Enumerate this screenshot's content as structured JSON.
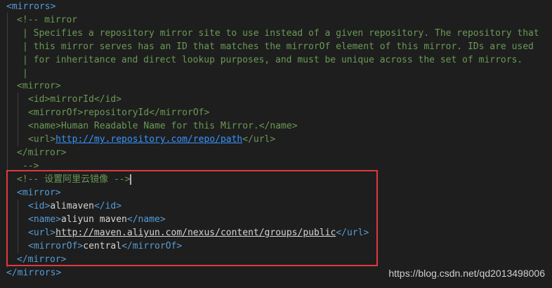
{
  "code": {
    "l1": "<mirrors>",
    "l2": "<!-- mirror",
    "l3": "| Specifies a repository mirror site to use instead of a given repository. The repository that",
    "l4": "| this mirror serves has an ID that matches the mirrorOf element of this mirror. IDs are used",
    "l5": "| for inheritance and direct lookup purposes, and must be unique across the set of mirrors.",
    "l6": "|",
    "l7": "<mirror>",
    "l8_open": "<id>",
    "l8_val": "mirrorId",
    "l8_close": "</id>",
    "l9_open": "<mirrorOf>",
    "l9_val": "repositoryId",
    "l9_close": "</mirrorOf>",
    "l10_open": "<name>",
    "l10_val": "Human Readable Name for this Mirror.",
    "l10_close": "</name>",
    "l11_open": "<url>",
    "l11_val": "http://my.repository.com/repo/path",
    "l11_close": "</url>",
    "l12": "</mirror>",
    "l13": "-->",
    "l14": "<!-- 设置阿里云镜像 -->",
    "l15": "<mirror>",
    "l16_open": "<id>",
    "l16_val": "alimaven",
    "l16_close": "</id>",
    "l17_open": "<name>",
    "l17_val": "aliyun maven",
    "l17_close": "</name>",
    "l18_open": "<url>",
    "l18_val": "http://maven.aliyun.com/nexus/content/groups/public",
    "l18_close": "</url>",
    "l19_open": "<mirrorOf>",
    "l19_val": "central",
    "l19_close": "</mirrorOf>",
    "l20": "</mirror>",
    "l21": "</mirrors>"
  },
  "watermark": "https://blog.csdn.net/qd2013498006",
  "colors": {
    "background": "#1e1e1e",
    "tag": "#569cd6",
    "comment": "#6a9955",
    "text": "#d4d4d4",
    "link": "#3794ff",
    "highlight_border": "#e0383e"
  }
}
